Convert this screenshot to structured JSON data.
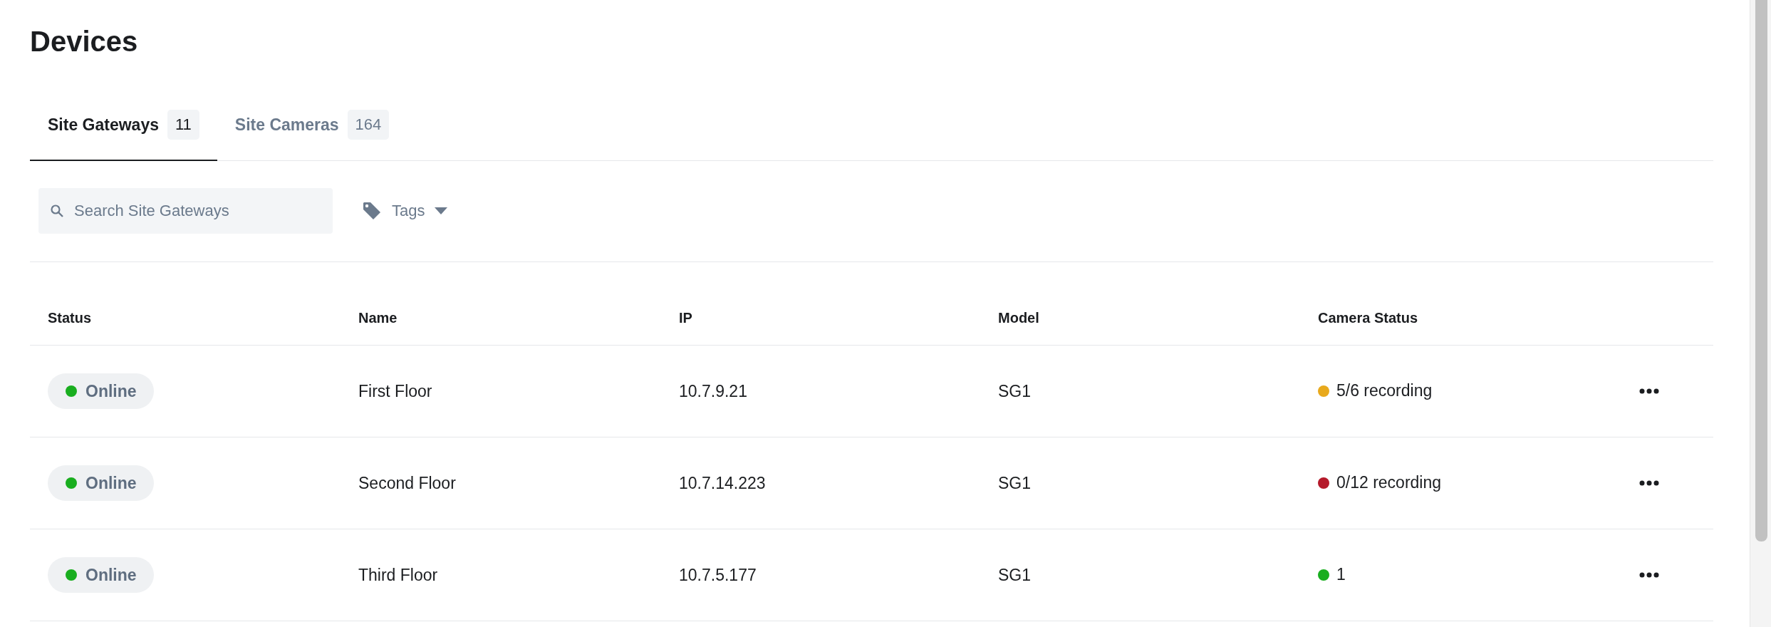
{
  "title": "Devices",
  "tabs": [
    {
      "label": "Site Gateways",
      "count": "11",
      "selected": true
    },
    {
      "label": "Site Cameras",
      "count": "164",
      "selected": false
    }
  ],
  "search": {
    "placeholder": "Search Site Gateways"
  },
  "tags_filter": {
    "label": "Tags"
  },
  "table": {
    "columns": [
      "Status",
      "Name",
      "IP",
      "Model",
      "Camera Status"
    ],
    "rows": [
      {
        "status": "Online",
        "name": "First Floor",
        "ip": "10.7.9.21",
        "model": "SG1",
        "camera_status": {
          "text": "5/6 recording",
          "color": "#e8a91c"
        }
      },
      {
        "status": "Online",
        "name": "Second Floor",
        "ip": "10.7.14.223",
        "model": "SG1",
        "camera_status": {
          "text": "0/12 recording",
          "color": "#b5192a"
        }
      },
      {
        "status": "Online",
        "name": "Third Floor",
        "ip": "10.7.5.177",
        "model": "SG1",
        "camera_status": {
          "text": "1",
          "color": "#19ae1f"
        }
      }
    ]
  }
}
